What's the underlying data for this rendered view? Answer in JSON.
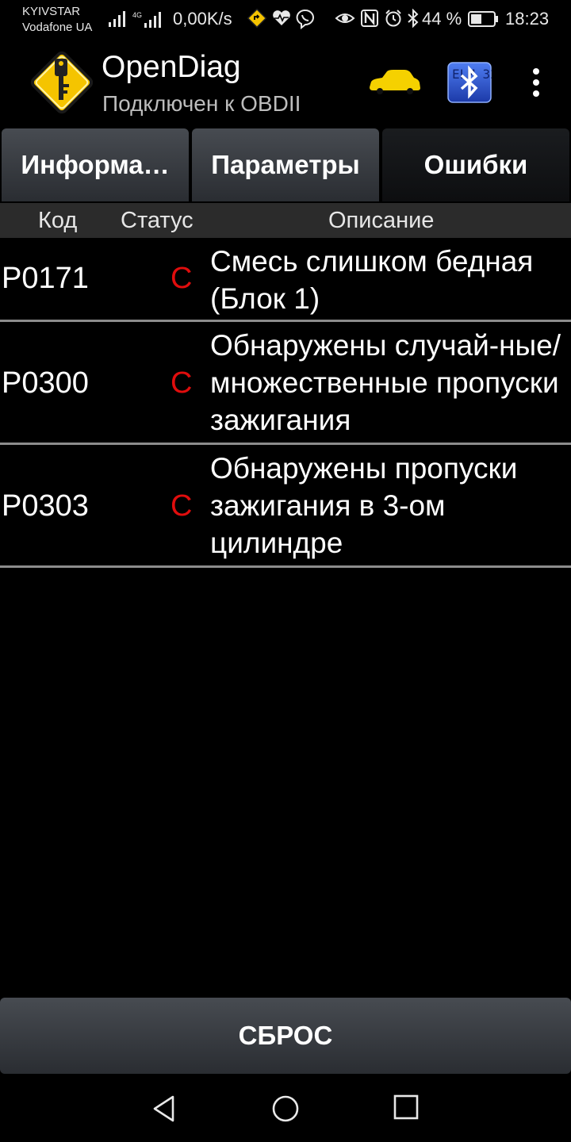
{
  "status_bar": {
    "carrier_1": "KYIVSTAR",
    "carrier_2": "Vodafone UA",
    "network_type": "4G",
    "net_speed": "0,00K/s",
    "battery_percent": "44 %",
    "time": "18:23",
    "icons": [
      "signal-icon",
      "signal-4g-icon",
      "route-icon",
      "heart-rate-icon",
      "viber-icon",
      "eye-icon",
      "nfc-icon",
      "alarm-icon",
      "bluetooth-icon",
      "battery-icon"
    ]
  },
  "app_bar": {
    "title": "OpenDiag",
    "subtitle": "Подключен к OBDII",
    "icons": [
      "app-logo-key-icon",
      "car-icon",
      "bluetooth-elm327-icon",
      "overflow-menu-icon"
    ],
    "bt_badge_text": "ELM 327"
  },
  "tabs": [
    {
      "label": "Информа…",
      "active": false
    },
    {
      "label": "Параметры",
      "active": false
    },
    {
      "label": "Ошибки",
      "active": true
    }
  ],
  "table": {
    "headers": {
      "code": "Код",
      "status": "Статус",
      "description": "Описание"
    },
    "rows": [
      {
        "code": "P0171",
        "status": "C",
        "description": "Смесь слишком бедная (Блок 1)"
      },
      {
        "code": "P0300",
        "status": "C",
        "description": "Обнаружены случай-ные/множественные пропуски зажигания"
      },
      {
        "code": "P0303",
        "status": "C",
        "description": "Обнаружены пропуски зажигания в 3-ом цилиндре"
      }
    ]
  },
  "reset_button": {
    "label": "СБРОС"
  },
  "nav_bar": {
    "icons": [
      "back-icon",
      "home-icon",
      "recents-icon"
    ]
  },
  "colors": {
    "background": "#000000",
    "status_error": "#e00d0d",
    "tab_gradient_top": "#474b51",
    "tab_gradient_bottom": "#2a2d32",
    "header_bg": "#2b2b2b",
    "separator": "#8c8c8c",
    "logo_yellow": "#f5c400",
    "bt_blue": "#2a55d6"
  }
}
